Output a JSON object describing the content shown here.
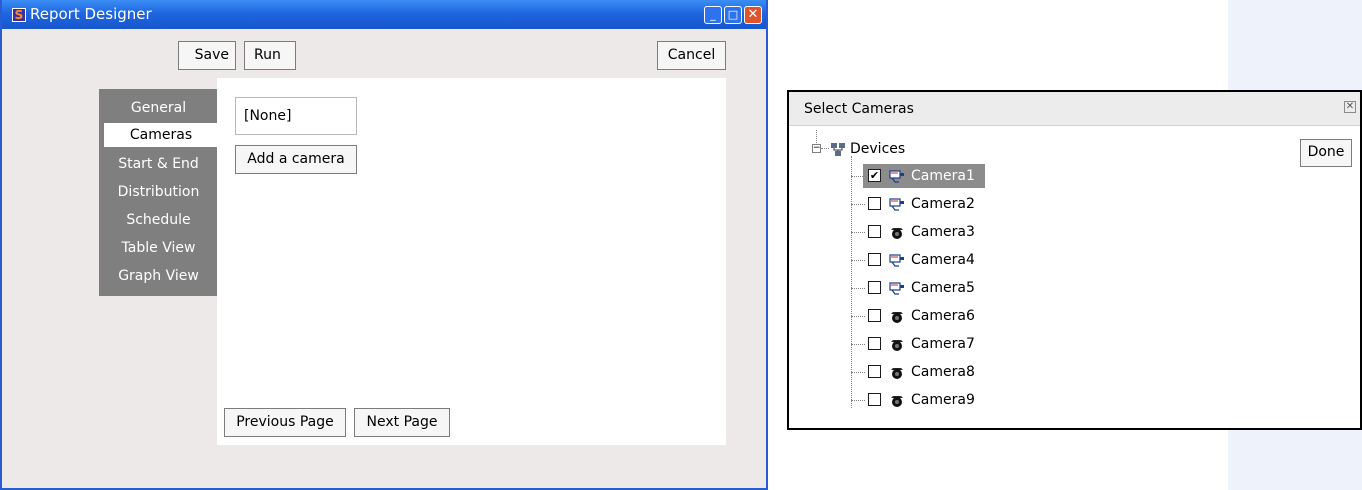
{
  "window": {
    "title": "Report Designer",
    "controls": {
      "minimize": "_",
      "maximize": "□",
      "close": "✕"
    },
    "icon_letter": "S"
  },
  "toolbar": {
    "save_label": "Save",
    "run_label": "Run",
    "cancel_label": "Cancel"
  },
  "nav": {
    "items": [
      {
        "label": "General",
        "active": false
      },
      {
        "label": "Cameras",
        "active": true
      },
      {
        "label": "Start & End",
        "active": false
      },
      {
        "label": "Distribution",
        "active": false
      },
      {
        "label": "Schedule",
        "active": false
      },
      {
        "label": "Table View",
        "active": false
      },
      {
        "label": "Graph View",
        "active": false
      }
    ]
  },
  "cameras_page": {
    "selected_value": "[None]",
    "add_camera_label": "Add a camera",
    "previous_page_label": "Previous Page",
    "next_page_label": "Next Page"
  },
  "select_cameras_dialog": {
    "title": "Select Cameras",
    "close_label": "✕",
    "done_label": "Done",
    "root_label": "Devices",
    "expander": "−",
    "cameras": [
      {
        "label": "Camera1",
        "checked": true,
        "icon": "box-camera-icon",
        "selected": true
      },
      {
        "label": "Camera2",
        "checked": false,
        "icon": "box-camera-icon",
        "selected": false
      },
      {
        "label": "Camera3",
        "checked": false,
        "icon": "dome-camera-icon",
        "selected": false
      },
      {
        "label": "Camera4",
        "checked": false,
        "icon": "box-camera-icon",
        "selected": false
      },
      {
        "label": "Camera5",
        "checked": false,
        "icon": "box-camera-icon",
        "selected": false
      },
      {
        "label": "Camera6",
        "checked": false,
        "icon": "dome-camera-icon",
        "selected": false
      },
      {
        "label": "Camera7",
        "checked": false,
        "icon": "dome-camera-icon",
        "selected": false
      },
      {
        "label": "Camera8",
        "checked": false,
        "icon": "dome-camera-icon",
        "selected": false
      },
      {
        "label": "Camera9",
        "checked": false,
        "icon": "dome-camera-icon",
        "selected": false
      }
    ]
  },
  "colors": {
    "titlebar": "#1f66e0",
    "nav_bg": "#7f7f7f",
    "selection": "#8c8c8c",
    "window_bg": "#ece9e8"
  }
}
